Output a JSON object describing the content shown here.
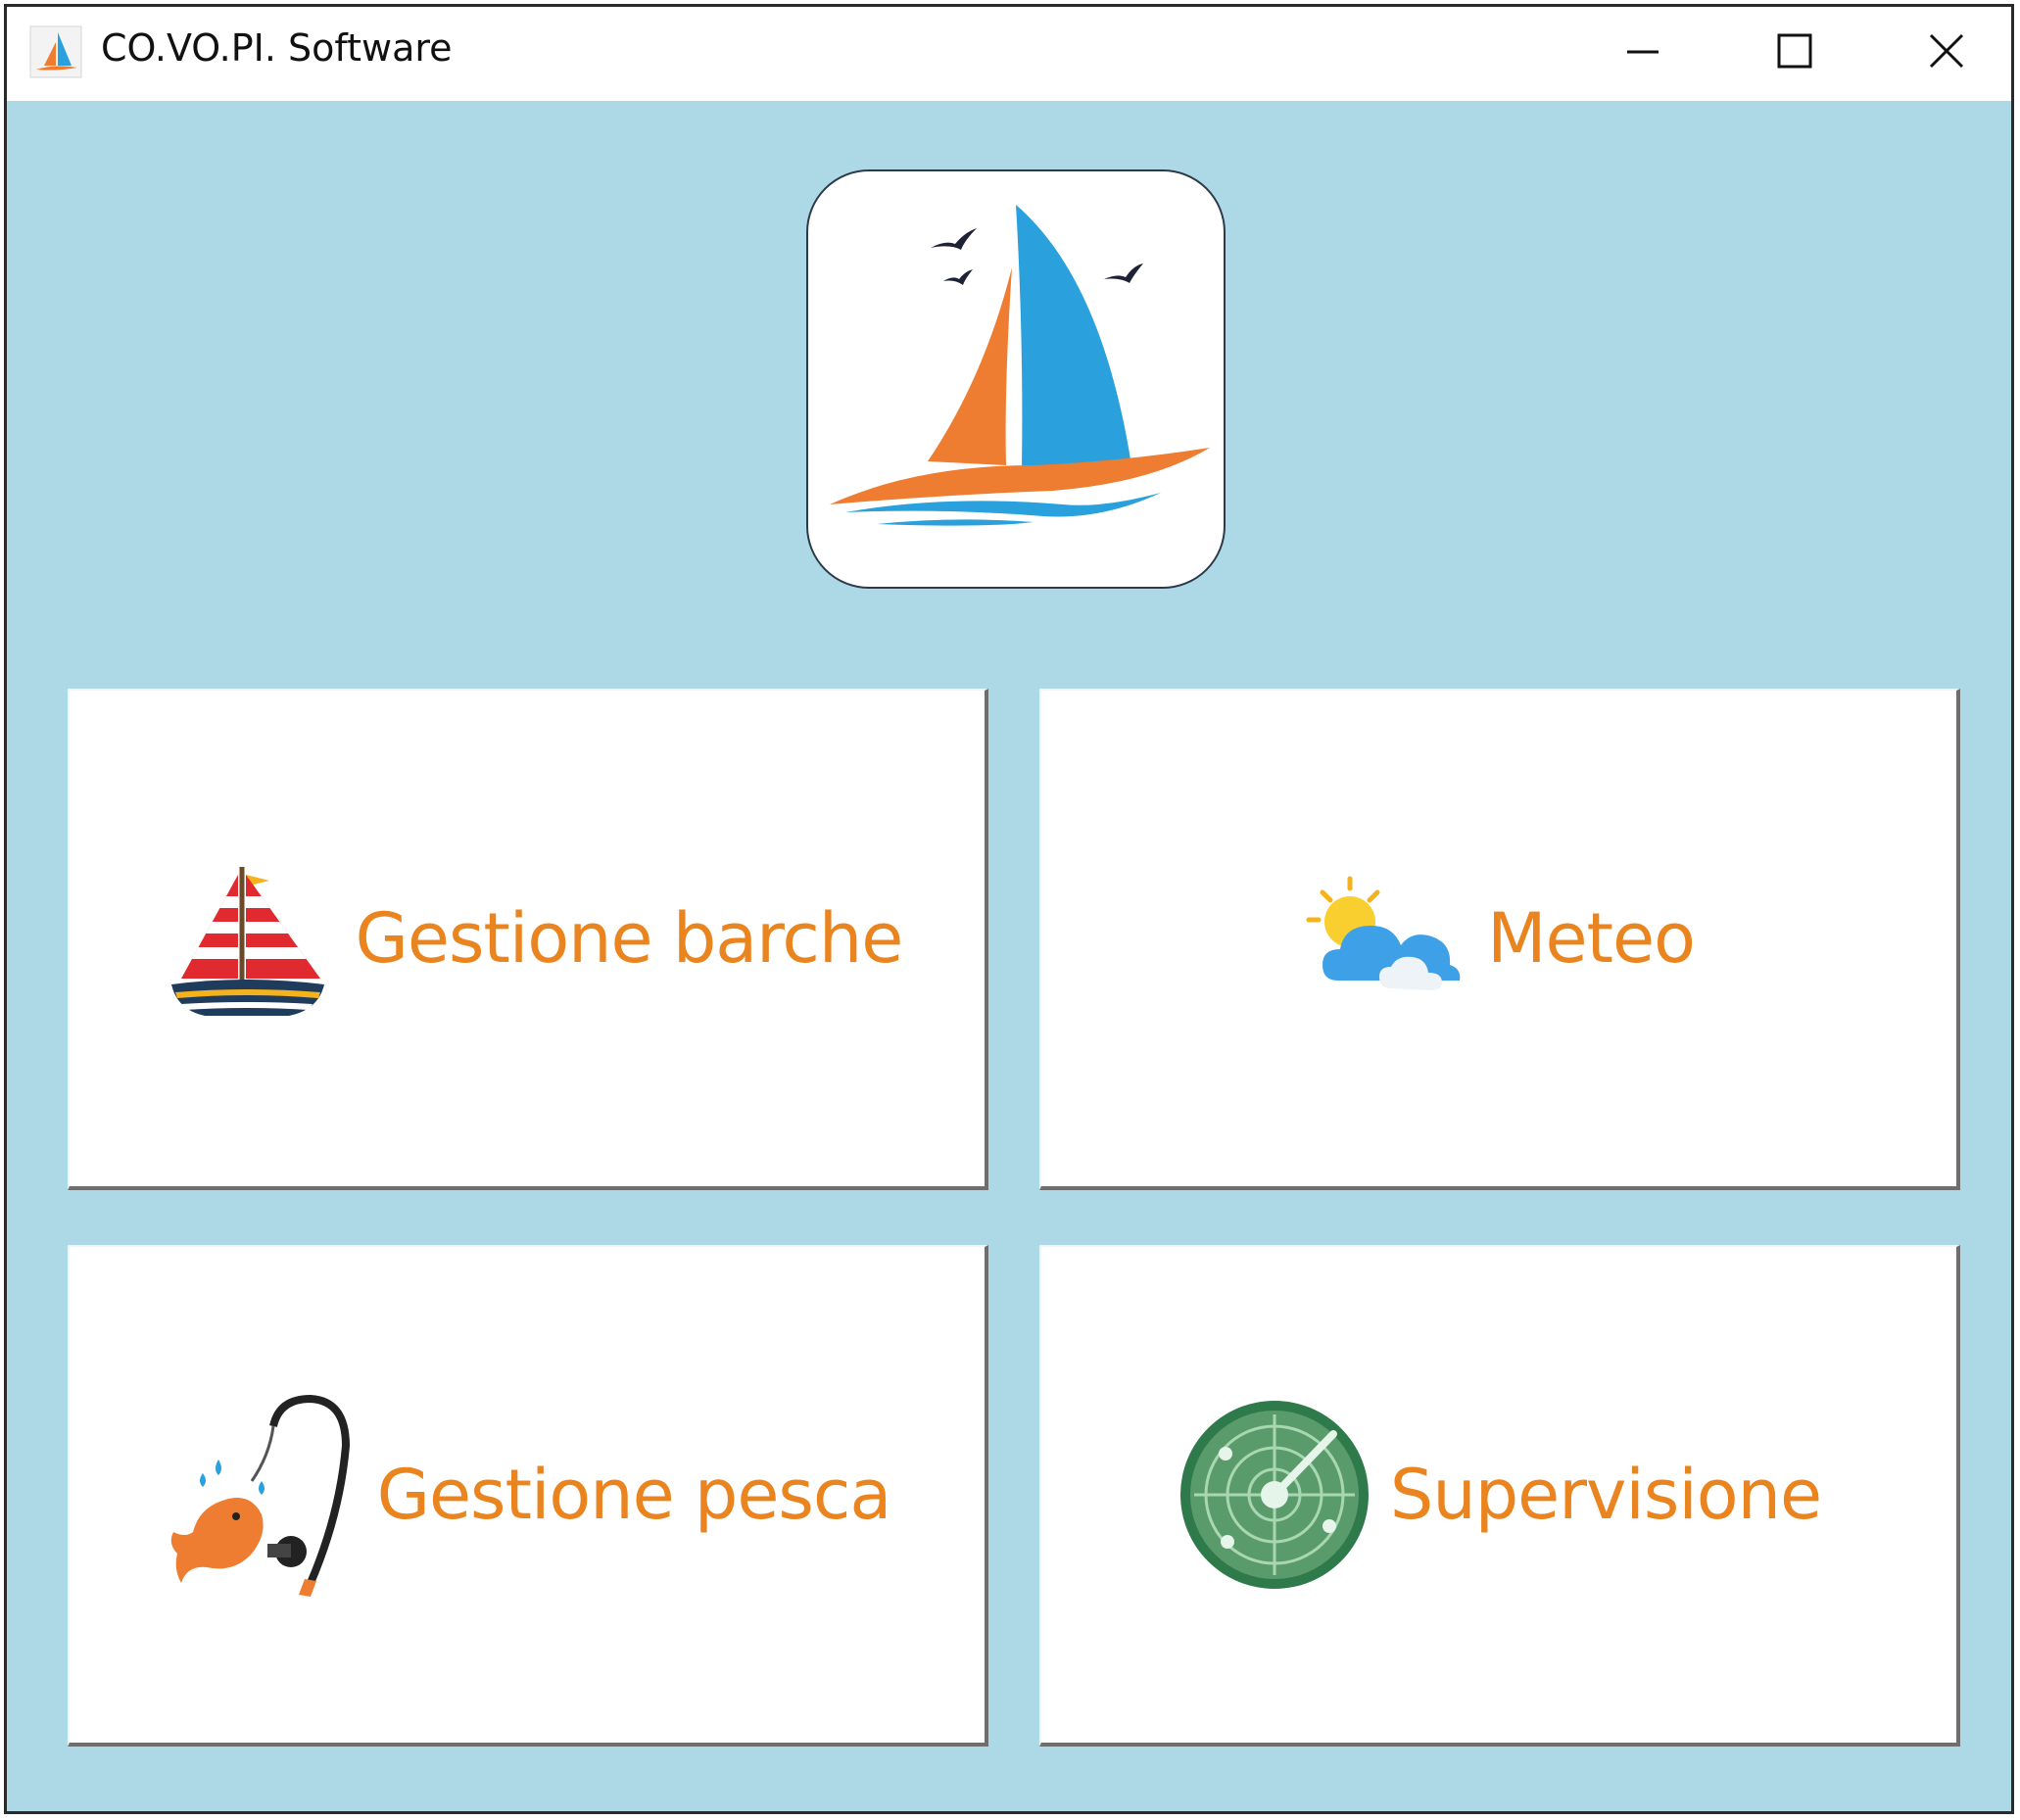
{
  "window": {
    "title": "CO.VO.PI. Software",
    "controls": {
      "minimize": "minimize-icon",
      "maximize": "maximize-icon",
      "close": "close-icon"
    }
  },
  "colors": {
    "background": "#add8e6",
    "accent_text": "#e9841f",
    "sail_blue": "#2aa0dc",
    "sail_orange": "#ee7d32"
  },
  "tiles": [
    {
      "label": "Gestione barche",
      "icon": "sailboat-icon"
    },
    {
      "label": "Meteo",
      "icon": "weather-icon"
    },
    {
      "label": "Gestione pesca",
      "icon": "fishing-icon"
    },
    {
      "label": "Supervisione",
      "icon": "radar-icon"
    }
  ]
}
